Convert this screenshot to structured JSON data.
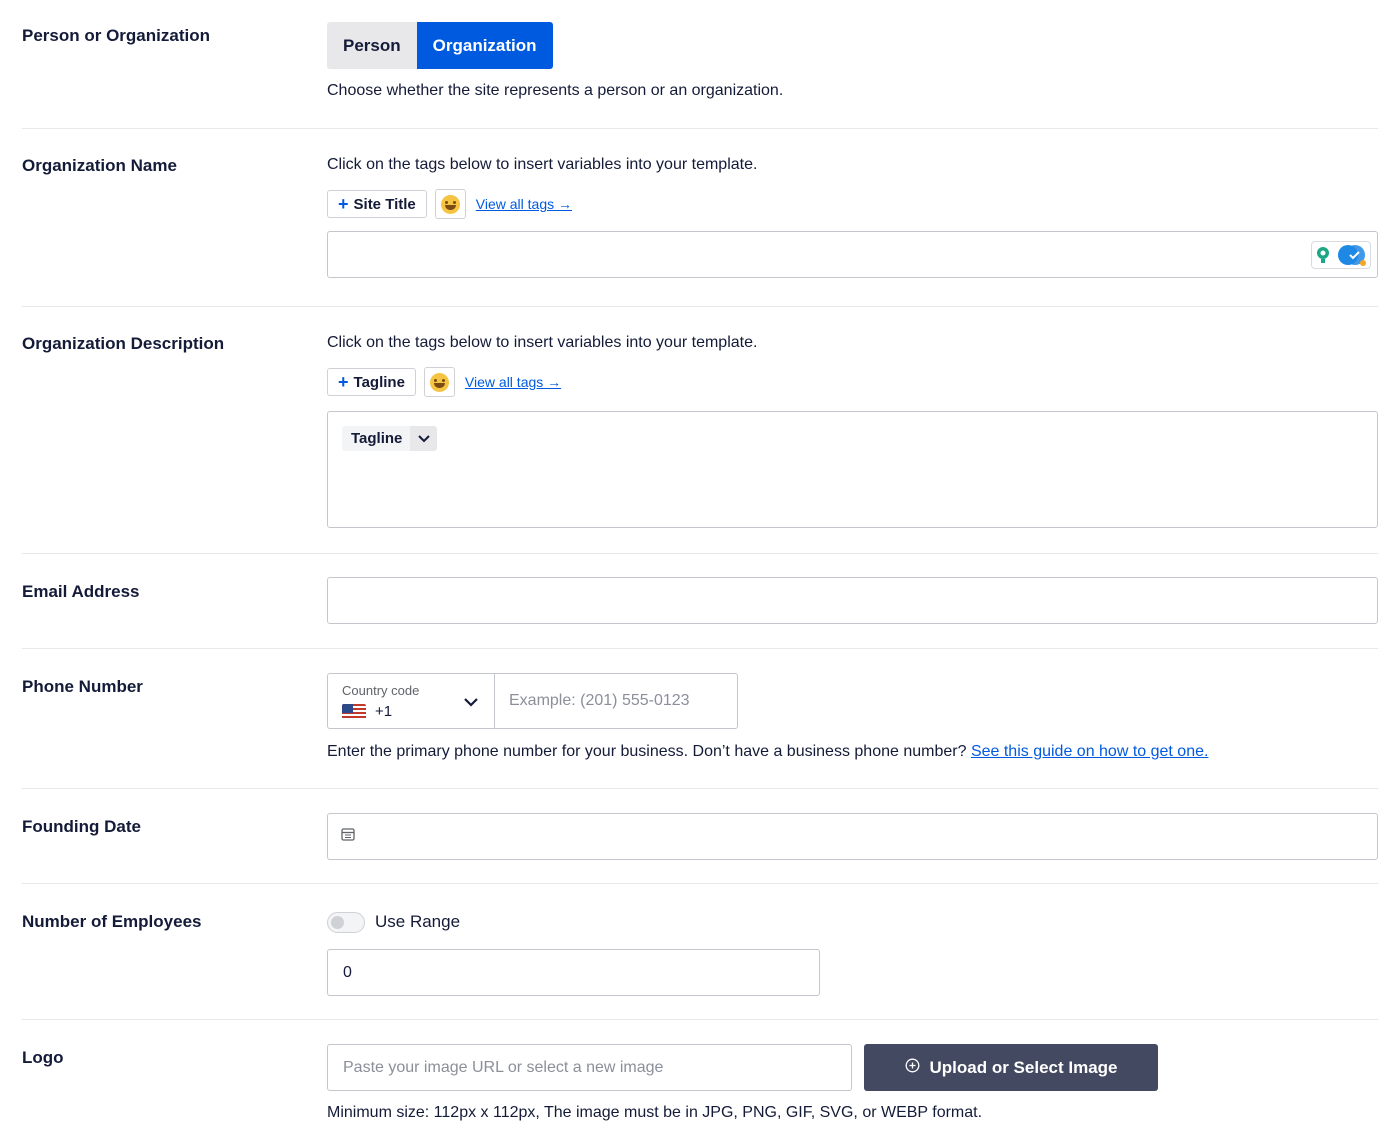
{
  "person_or_org": {
    "label": "Person or Organization",
    "options": [
      "Person",
      "Organization"
    ],
    "selected": "Organization",
    "help": "Choose whether the site represents a person or an organization."
  },
  "org_name": {
    "label": "Organization Name",
    "help": "Click on the tags below to insert variables into your template.",
    "tag_button": "Site Title",
    "view_all": "View all tags →",
    "value": ""
  },
  "org_description": {
    "label": "Organization Description",
    "help": "Click on the tags below to insert variables into your template.",
    "tag_button": "Tagline",
    "view_all": "View all tags →",
    "inserted_tag": "Tagline"
  },
  "email": {
    "label": "Email Address",
    "value": ""
  },
  "phone": {
    "label": "Phone Number",
    "country_code_label": "Country code",
    "country_code_value": "+1",
    "placeholder": "Example: (201) 555-0123",
    "help": "Enter the primary phone number for your business. Don’t have a business phone number?",
    "help_link": "See this guide on how to get one."
  },
  "founding_date": {
    "label": "Founding Date",
    "value": ""
  },
  "employees": {
    "label": "Number of Employees",
    "toggle_label": "Use Range",
    "toggle_on": false,
    "value": "0"
  },
  "logo": {
    "label": "Logo",
    "placeholder": "Paste your image URL or select a new image",
    "button": "Upload or Select Image",
    "help": "Minimum size: 112px x 112px, The image must be in JPG, PNG, GIF, SVG, or WEBP format."
  },
  "colors": {
    "accent": "#005ae0",
    "text": "#141b38",
    "button_dark": "#434960"
  },
  "icons": [
    "plus-icon",
    "emoji-icon",
    "chevron-down-icon",
    "us-flag-icon",
    "calendar-icon",
    "upload-circle-plus-icon",
    "grammar-assistant-icon"
  ]
}
